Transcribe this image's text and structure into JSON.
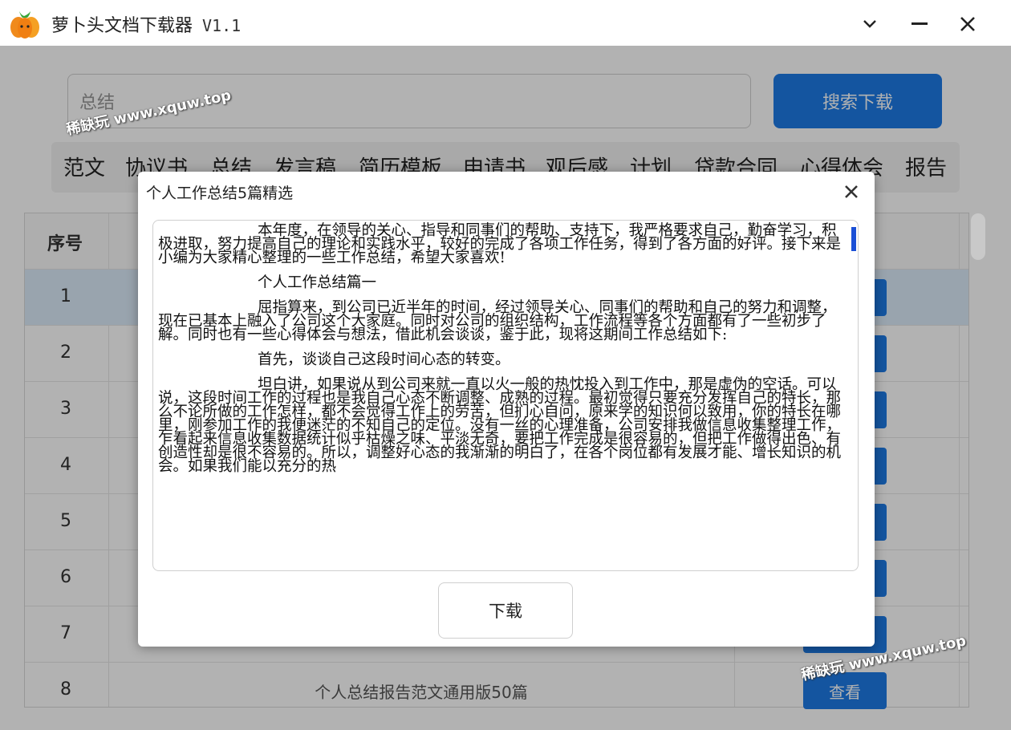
{
  "app": {
    "title": "萝卜头文档下载器",
    "version": "V1.1"
  },
  "window_controls": [
    "chevron-down",
    "minimize",
    "close"
  ],
  "search": {
    "value": "总结",
    "button_label": "搜索下载"
  },
  "categories": [
    "范文",
    "协议书",
    "总结",
    "发言稿",
    "简历模板",
    "申请书",
    "观后感",
    "计划",
    "贷款合同",
    "心得体会",
    "报告"
  ],
  "table": {
    "header_no": "序号",
    "rows": [
      {
        "no": "1",
        "title": "",
        "action": ""
      },
      {
        "no": "2",
        "title": "",
        "action": ""
      },
      {
        "no": "3",
        "title": "",
        "action": ""
      },
      {
        "no": "4",
        "title": "",
        "action": ""
      },
      {
        "no": "5",
        "title": "",
        "action": ""
      },
      {
        "no": "6",
        "title": "",
        "action": ""
      },
      {
        "no": "7",
        "title": "",
        "action": ""
      },
      {
        "no": "8",
        "title": "个人总结报告范文通用版50篇",
        "action": "查看"
      }
    ],
    "selected_row": 1
  },
  "dialog": {
    "title": "个人工作总结5篇精选",
    "paragraphs": [
      "本年度，在领导的关心、指导和同事们的帮助、支持下，我严格要求自己，勤奋学习，积极进取，努力提高自己的理论和实践水平，较好的完成了各项工作任务，得到了各方面的好评。接下来是小编为大家精心整理的一些工作总结，希望大家喜欢!",
      "个人工作总结篇一",
      "屈指算来，到公司已近半年的时间，经过领导关心、同事们的帮助和自己的努力和调整，现在已基本上融入了公司这个大家庭。同时对公司的组织结构，工作流程等各个方面都有了一些初步了解。同时也有一些心得体会与想法，借此机会谈谈，鉴于此，现将这期间工作总结如下:",
      "首先，谈谈自己这段时间心态的转变。",
      "坦白讲，如果说从到公司来就一直以火一般的热忱投入到工作中，那是虚伪的空话。可以说，这段时间工作的过程也是我自己心态不断调整、成熟的过程。最初觉得只要充分发挥自己的特长，那么不论所做的工作怎样，都不会觉得工作上的劳苦，但扪心自问，原来学的知识何以致用，你的特长在哪里，刚参加工作的我便迷茫的不知自己的定位。没有一丝的心理准备，公司安排我做信息收集整理工作，乍看起来信息收集数据统计似乎枯燥之味、平淡无奇，要把工作完成是很容易的，但把工作做得出色、有创造性却是很不容易的。所以，调整好心态的我渐渐的明白了，在各个岗位都有发展才能、增长知识的机会。如果我们能以充分的热"
    ],
    "download_label": "下载"
  },
  "watermark": "稀缺玩 www.xquw.top",
  "colors": {
    "accent": "#1e7ae6",
    "selected_row": "#dcebfa",
    "overlay": "rgba(0,0,0,0.30)"
  }
}
